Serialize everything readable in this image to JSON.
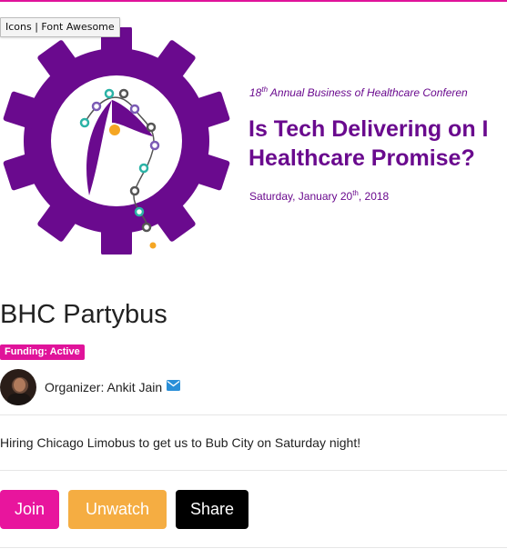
{
  "tooltip": "Icons | Font Awesome",
  "banner": {
    "conference_prefix": "18",
    "conference_suffix": "th",
    "conference_name": " Annual Business of Healthcare Conferen",
    "headline_line1": "Is Tech Delivering on I",
    "headline_line2": "Healthcare Promise?",
    "date_prefix": "Saturday, January 20",
    "date_suffix": "th",
    "date_year": ", 2018"
  },
  "campaign": {
    "title": "BHC Partybus",
    "status_badge": "Funding: Active",
    "organizer_label": "Organizer: Ankit Jain",
    "description": "Hiring Chicago Limobus to get us to Bub City on Saturday night!"
  },
  "actions": {
    "join": "Join",
    "unwatch": "Unwatch",
    "share": "Share"
  },
  "icons": {
    "mail": "envelope-icon",
    "logo": "gear-dna-figure-logo"
  },
  "colors": {
    "accent_pink": "#e0139a",
    "brand_purple": "#6a0a8e",
    "unwatch_orange": "#f5ad42",
    "share_black": "#000000",
    "mail_blue": "#2a8fd8"
  }
}
